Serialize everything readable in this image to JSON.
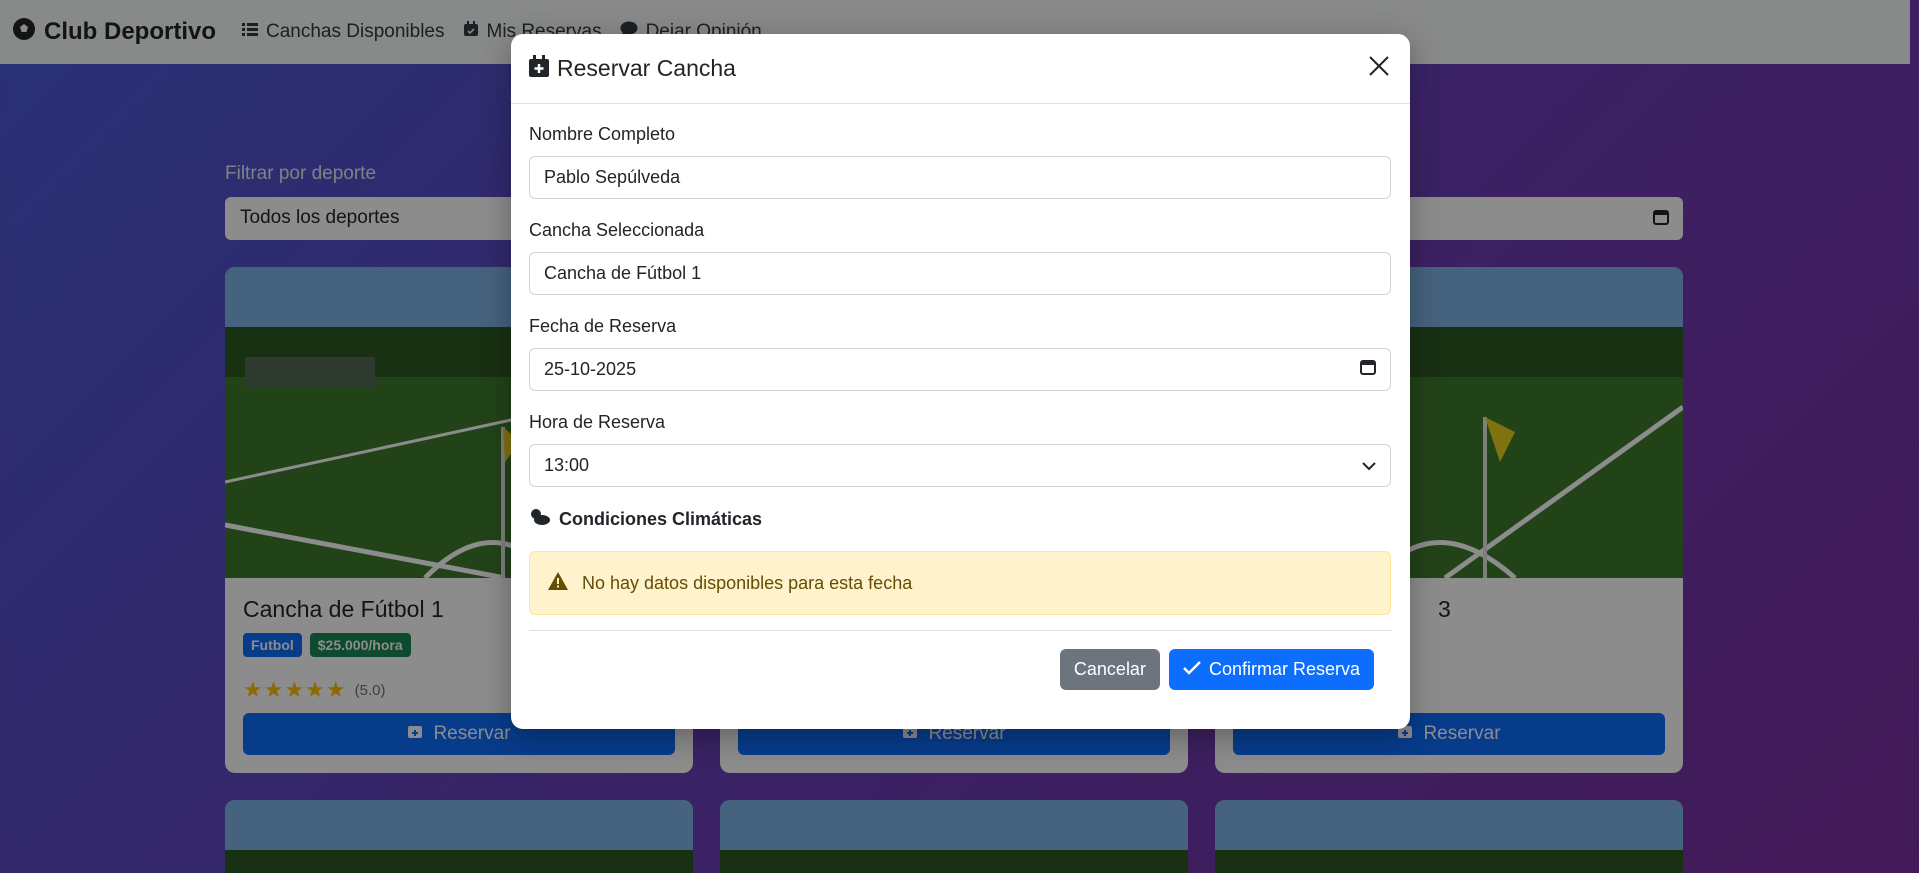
{
  "navbar": {
    "brand": "Club Deportivo",
    "links": [
      {
        "label": "Canchas Disponibles",
        "icon": "list-icon"
      },
      {
        "label": "Mis Reservas",
        "icon": "calendar-check-icon"
      },
      {
        "label": "Dejar Opinión",
        "icon": "comment-icon"
      }
    ]
  },
  "filters": {
    "label": "Filtrar por deporte",
    "selected": "Todos los deportes"
  },
  "cards": [
    {
      "title": "Cancha de Fútbol 1",
      "badge_sport": "Futbol",
      "badge_price": "$25.000/hora",
      "stars": "★★★★★",
      "rating": "(5.0)",
      "button": "Reservar"
    },
    {
      "title": "",
      "button": "Reservar"
    },
    {
      "title": "3",
      "button": "Reservar"
    }
  ],
  "modal": {
    "title": "Reservar Cancha",
    "fields": {
      "name_label": "Nombre Completo",
      "name_value": "Pablo Sepúlveda",
      "court_label": "Cancha Seleccionada",
      "court_value": "Cancha de Fútbol 1",
      "date_label": "Fecha de Reserva",
      "date_value": "25-10-2025",
      "time_label": "Hora de Reserva",
      "time_value": "13:00"
    },
    "weather_title": "Condiciones Climáticas",
    "alert_text": "No hay datos disponibles para esta fecha",
    "cancel_label": "Cancelar",
    "confirm_label": "Confirmar Reserva"
  },
  "colors": {
    "primary": "#0d6efd",
    "secondary": "#6c757d",
    "success": "#198754",
    "warning_bg": "#fff3cd",
    "warning_text": "#664d03"
  }
}
